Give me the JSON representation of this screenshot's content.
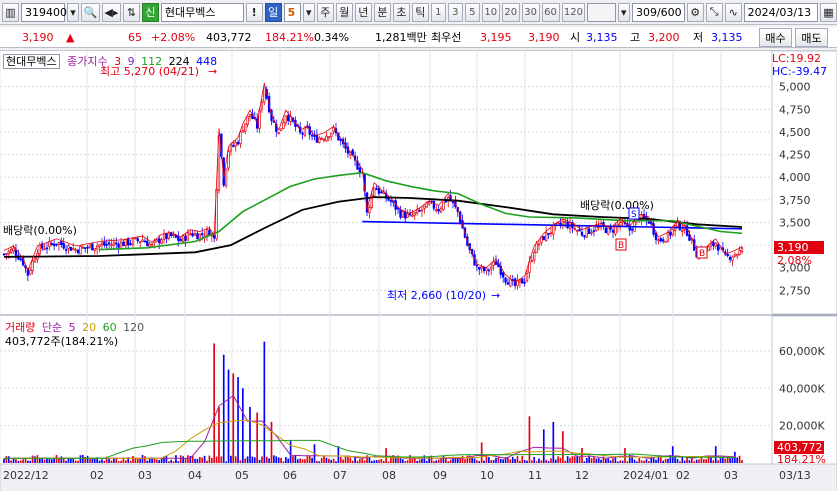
{
  "toolbar": {
    "code": "319400",
    "name_tag": "신",
    "name": "현대무벡스",
    "period_label": "일",
    "period_value": "5",
    "periods": [
      "주",
      "월",
      "년",
      "분",
      "초",
      "틱"
    ],
    "numbers": [
      "1",
      "3",
      "5",
      "10",
      "20",
      "30",
      "60",
      "120"
    ],
    "count": "309",
    "count_total": "/600",
    "date": "2024/03/13"
  },
  "quote": {
    "price": "3,190",
    "change": "65",
    "change_pct": "+2.08%",
    "volume": "403,772",
    "volume_pct": "184.21%",
    "turnover": "0.34%",
    "amount": "1,281백만",
    "best_label": "최우선",
    "best_ask": "3,195",
    "best_bid": "3,190",
    "open_label": "시",
    "open": "3,135",
    "high_label": "고",
    "high": "3,200",
    "low_label": "저",
    "low": "3,135",
    "buy": "매수",
    "sell": "매도"
  },
  "price_panel": {
    "title": "현대무벡스",
    "indicator": "종가지수",
    "ma": [
      "3",
      "9",
      "112",
      "224",
      "448"
    ],
    "ma_colors": [
      "#e1000f",
      "#7a2bc9",
      "#1ea01e",
      "#000000",
      "#0000ff"
    ],
    "high_label": "최고 5,270 (04/21)",
    "low_label": "최저 2,660 (10/20)",
    "div_left": "배당락(0.00%)",
    "div_right": "배당락(0.00%)",
    "lc": "LC:19.92",
    "hc": "HC:-39.47",
    "current_price": "3,190",
    "current_pct": "2.08%",
    "marker_b": "B",
    "marker_s": "S"
  },
  "volume_panel": {
    "title": "거래량",
    "mode": "단순",
    "ma": [
      "5",
      "20",
      "60",
      "120"
    ],
    "ma_colors": [
      "#a020a0",
      "#c8a000",
      "#1ea01e",
      "#555555"
    ],
    "summary": "403,772주(184.21%)",
    "current_volume": "403,772",
    "current_pct": "184.21%"
  },
  "chart_data": {
    "type": "candlestick",
    "x_ticks": [
      "2022/12",
      "02",
      "03",
      "04",
      "05",
      "06",
      "07",
      "08",
      "09",
      "10",
      "11",
      "12",
      "2024/01",
      "02",
      "03",
      "03/13"
    ],
    "price_ticks": [
      "5,000",
      "4,750",
      "4,500",
      "4,250",
      "4,000",
      "3,750",
      "3,500",
      "3,250",
      "3,000",
      "2,750"
    ],
    "price_tick_values": [
      5000,
      4750,
      4500,
      4250,
      4000,
      3750,
      3500,
      3250,
      3000,
      2750
    ],
    "price_range": [
      2500,
      5350
    ],
    "volume_ticks": [
      "60,000K",
      "40,000K",
      "20,000K"
    ],
    "volume_tick_values": [
      60000,
      40000,
      20000
    ],
    "volume_range": [
      0,
      68000
    ],
    "close_path": [
      [
        0,
        3150
      ],
      [
        4,
        3200
      ],
      [
        8,
        3060
      ],
      [
        10,
        2930
      ],
      [
        14,
        3200
      ],
      [
        22,
        3280
      ],
      [
        30,
        3200
      ],
      [
        40,
        3250
      ],
      [
        50,
        3270
      ],
      [
        58,
        3310
      ],
      [
        62,
        3240
      ],
      [
        66,
        3330
      ],
      [
        70,
        3350
      ],
      [
        74,
        3300
      ],
      [
        78,
        3380
      ],
      [
        82,
        3360
      ],
      [
        86,
        3400
      ],
      [
        88,
        3320
      ],
      [
        90,
        4500
      ],
      [
        92,
        3950
      ],
      [
        94,
        4300
      ],
      [
        98,
        4400
      ],
      [
        100,
        4550
      ],
      [
        103,
        4700
      ],
      [
        106,
        4560
      ],
      [
        109,
        5000
      ],
      [
        112,
        4650
      ],
      [
        115,
        4480
      ],
      [
        118,
        4700
      ],
      [
        121,
        4600
      ],
      [
        124,
        4480
      ],
      [
        127,
        4520
      ],
      [
        130,
        4420
      ],
      [
        134,
        4450
      ],
      [
        138,
        4520
      ],
      [
        142,
        4350
      ],
      [
        146,
        4200
      ],
      [
        150,
        4050
      ],
      [
        152,
        3600
      ],
      [
        155,
        3900
      ],
      [
        158,
        3820
      ],
      [
        162,
        3730
      ],
      [
        166,
        3600
      ],
      [
        170,
        3560
      ],
      [
        174,
        3620
      ],
      [
        178,
        3700
      ],
      [
        182,
        3650
      ],
      [
        186,
        3780
      ],
      [
        190,
        3620
      ],
      [
        194,
        3250
      ],
      [
        198,
        3000
      ],
      [
        202,
        2960
      ],
      [
        206,
        3060
      ],
      [
        210,
        2880
      ],
      [
        214,
        2800
      ],
      [
        218,
        2870
      ],
      [
        222,
        3200
      ],
      [
        226,
        3340
      ],
      [
        230,
        3430
      ],
      [
        234,
        3500
      ],
      [
        238,
        3450
      ],
      [
        242,
        3380
      ],
      [
        246,
        3420
      ],
      [
        250,
        3450
      ],
      [
        254,
        3400
      ],
      [
        258,
        3500
      ],
      [
        262,
        3420
      ],
      [
        266,
        3550
      ],
      [
        270,
        3520
      ],
      [
        274,
        3300
      ],
      [
        278,
        3350
      ],
      [
        282,
        3480
      ],
      [
        286,
        3400
      ],
      [
        290,
        3160
      ],
      [
        294,
        3190
      ],
      [
        298,
        3280
      ],
      [
        302,
        3110
      ],
      [
        306,
        3150
      ],
      [
        309,
        3190
      ]
    ],
    "ma_112": [
      [
        40,
        3200
      ],
      [
        60,
        3220
      ],
      [
        80,
        3290
      ],
      [
        90,
        3400
      ],
      [
        100,
        3620
      ],
      [
        110,
        3760
      ],
      [
        120,
        3900
      ],
      [
        130,
        3980
      ],
      [
        140,
        4020
      ],
      [
        150,
        4050
      ],
      [
        160,
        3960
      ],
      [
        170,
        3900
      ],
      [
        180,
        3850
      ],
      [
        190,
        3820
      ],
      [
        200,
        3700
      ],
      [
        210,
        3600
      ],
      [
        220,
        3560
      ],
      [
        240,
        3550
      ],
      [
        260,
        3520
      ],
      [
        280,
        3520
      ],
      [
        300,
        3400
      ],
      [
        309,
        3380
      ]
    ],
    "ma_224": [
      [
        0,
        3120
      ],
      [
        40,
        3130
      ],
      [
        80,
        3170
      ],
      [
        95,
        3250
      ],
      [
        110,
        3450
      ],
      [
        125,
        3640
      ],
      [
        140,
        3730
      ],
      [
        155,
        3780
      ],
      [
        170,
        3770
      ],
      [
        190,
        3740
      ],
      [
        210,
        3670
      ],
      [
        230,
        3590
      ],
      [
        250,
        3560
      ],
      [
        270,
        3540
      ],
      [
        290,
        3480
      ],
      [
        309,
        3450
      ]
    ],
    "ma_448": [
      [
        150,
        3510
      ],
      [
        170,
        3500
      ],
      [
        190,
        3490
      ],
      [
        210,
        3480
      ],
      [
        230,
        3470
      ],
      [
        250,
        3460
      ],
      [
        270,
        3450
      ],
      [
        290,
        3440
      ],
      [
        309,
        3430
      ]
    ],
    "volume_spikes": [
      [
        88,
        64000
      ],
      [
        90,
        30000
      ],
      [
        92,
        58000
      ],
      [
        94,
        50000
      ],
      [
        96,
        48000
      ],
      [
        98,
        46000
      ],
      [
        100,
        40000
      ],
      [
        103,
        30000
      ],
      [
        106,
        27000
      ],
      [
        109,
        65000
      ],
      [
        112,
        22000
      ],
      [
        120,
        12000
      ],
      [
        130,
        10000
      ],
      [
        140,
        9000
      ],
      [
        160,
        8000
      ],
      [
        200,
        11000
      ],
      [
        220,
        25000
      ],
      [
        226,
        18000
      ],
      [
        230,
        22000
      ],
      [
        234,
        17000
      ],
      [
        242,
        8000
      ],
      [
        260,
        8000
      ],
      [
        280,
        9000
      ],
      [
        298,
        9000
      ],
      [
        306,
        6000
      ]
    ],
    "total_bars": 310
  }
}
